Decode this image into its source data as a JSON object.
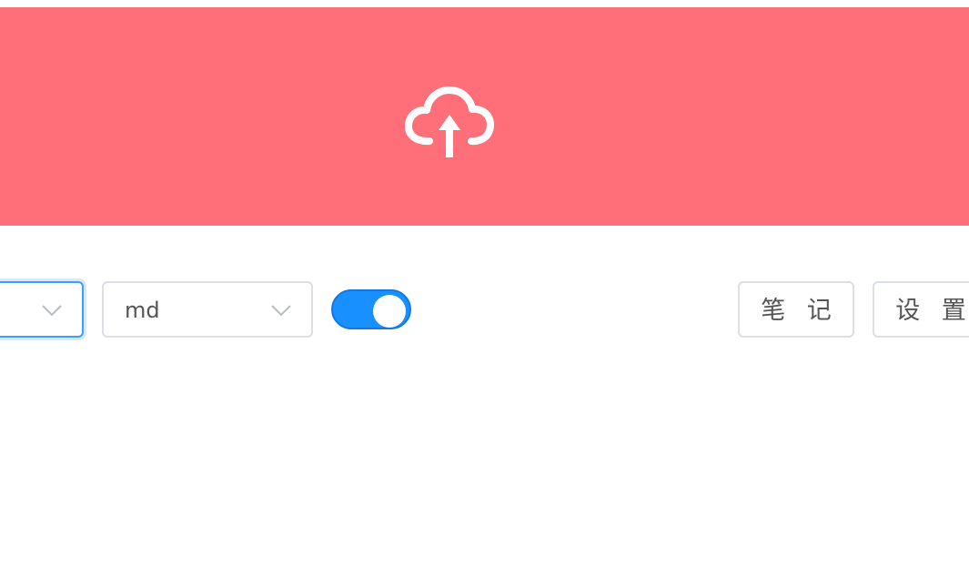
{
  "colors": {
    "upload_background": "#ff6f7a",
    "accent": "#1890ff",
    "border": "#dcdfe6",
    "focus_border": "#409eff",
    "text": "#555555"
  },
  "upload": {
    "icon": "cloud-upload-icon"
  },
  "toolbar": {
    "select_one": {
      "value": "",
      "icon": "chevron-down-icon"
    },
    "select_two": {
      "value": "md",
      "icon": "chevron-down-icon"
    },
    "toggle": {
      "checked": true
    },
    "notes_label": "笔 记",
    "settings_label": "设 置"
  }
}
